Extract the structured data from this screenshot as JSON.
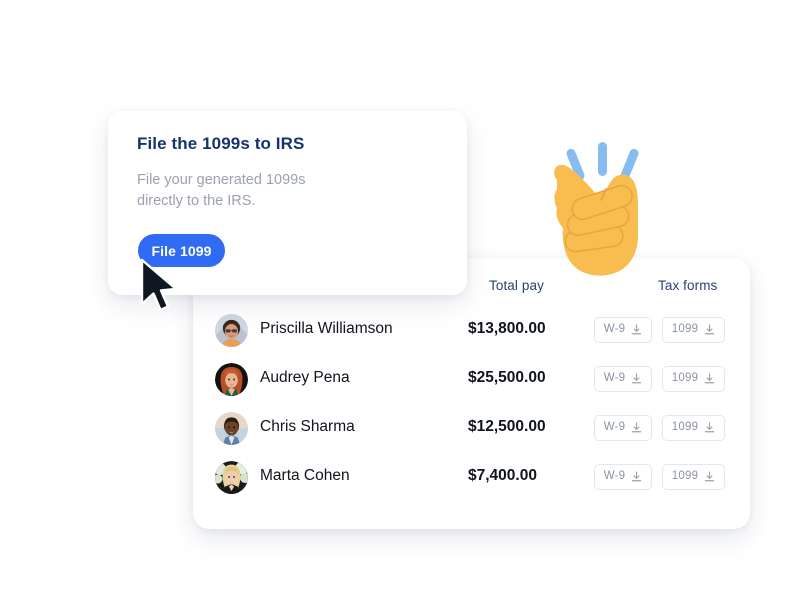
{
  "promo": {
    "title": "File the 1099s to IRS",
    "description": "File your generated 1099s directly to the IRS.",
    "button_label": "File 1099",
    "button_color": "#316bf4",
    "title_color": "#17326e",
    "description_color": "#9aa1ad"
  },
  "table": {
    "headers": {
      "name": "",
      "total_pay": "Total pay",
      "tax_forms": "Tax forms"
    },
    "header_color": "#2b3f77",
    "rows": [
      {
        "name": "Priscilla Williamson",
        "total_pay": "$13,800.00",
        "w9_label": "W-9",
        "form1099_label": "1099",
        "avatar": "avatar-priscilla"
      },
      {
        "name": "Audrey Pena",
        "total_pay": "$25,500.00",
        "w9_label": "W-9",
        "form1099_label": "1099",
        "avatar": "avatar-audrey"
      },
      {
        "name": "Chris Sharma",
        "total_pay": "$12,500.00",
        "w9_label": "W-9",
        "form1099_label": "1099",
        "avatar": "avatar-chris"
      },
      {
        "name": "Marta Cohen",
        "total_pay": "$7,400.00",
        "w9_label": "W-9",
        "form1099_label": "1099",
        "avatar": "avatar-marta"
      }
    ]
  },
  "decorations": {
    "emoji": "snapping-fingers-emoji",
    "emoji_color": "#f9bc4f",
    "motion_line_color": "#86bcf0",
    "cursor": "mouse-pointer-cursor",
    "cursor_color": "#0f1722"
  }
}
